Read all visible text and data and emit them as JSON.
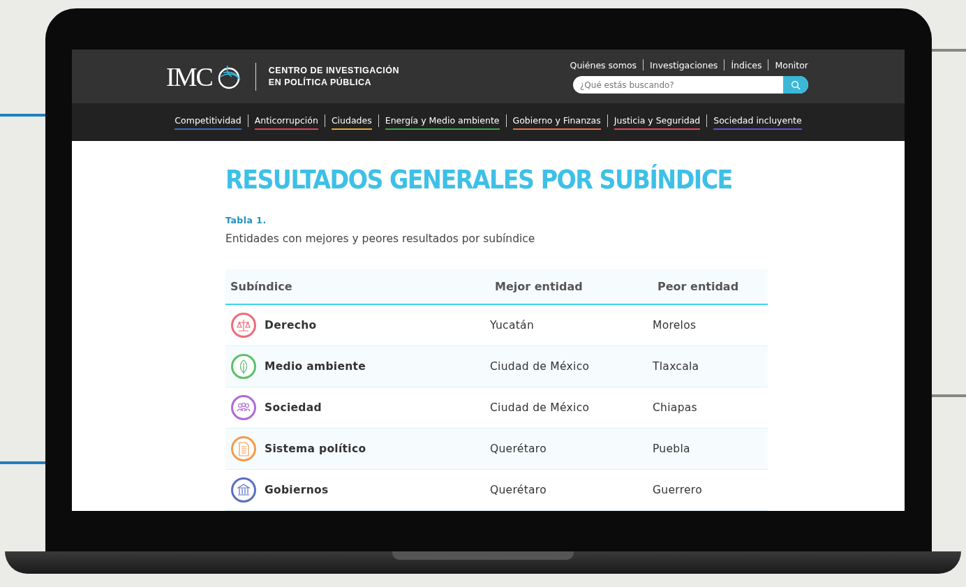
{
  "header": {
    "logo_text": "IMC",
    "org_name_line1": "CENTRO DE INVESTIGACIÓN",
    "org_name_line2": "EN POLÍTICA PÚBLICA",
    "top_links": [
      "Quiénes somos",
      "Investigaciones",
      "Índices",
      "Monitor"
    ],
    "search": {
      "placeholder": "¿Qué estás buscando?"
    }
  },
  "nav": [
    {
      "label": "Competitividad",
      "color": "#3a6fc4"
    },
    {
      "label": "Anticorrupción",
      "color": "#d9475a"
    },
    {
      "label": "Ciudades",
      "color": "#e8a53a"
    },
    {
      "label": "Energía y Medio ambiente",
      "color": "#3aa64a"
    },
    {
      "label": "Gobierno y Finanzas",
      "color": "#e8734a"
    },
    {
      "label": "Justicia y Seguridad",
      "color": "#e0485e"
    },
    {
      "label": "Sociedad incluyente",
      "color": "#6a4fd6"
    }
  ],
  "page_title": "RESULTADOS GENERALES POR SUBÍNDICE",
  "table_label": "Tabla 1.",
  "table_caption": "Entidades con mejores y peores resultados por subíndice",
  "table": {
    "columns": [
      "Subíndice",
      "Mejor entidad",
      "Peor entidad"
    ],
    "rows": [
      {
        "kind": "scales",
        "color": "#ef6b7b",
        "subindex": "Derecho",
        "best": "Yucatán",
        "worst": "Morelos"
      },
      {
        "kind": "leaf",
        "color": "#5cbf6a",
        "subindex": "Medio ambiente",
        "best": "Ciudad de México",
        "worst": "Tlaxcala"
      },
      {
        "kind": "people",
        "color": "#b06ad6",
        "subindex": "Sociedad",
        "best": "Ciudad de México",
        "worst": "Chiapas"
      },
      {
        "kind": "document",
        "color": "#f39a4e",
        "subindex": "Sistema político",
        "best": "Querétaro",
        "worst": "Puebla"
      },
      {
        "kind": "building",
        "color": "#5a6fc0",
        "subindex": "Gobiernos",
        "best": "Querétaro",
        "worst": "Guerrero"
      }
    ]
  }
}
